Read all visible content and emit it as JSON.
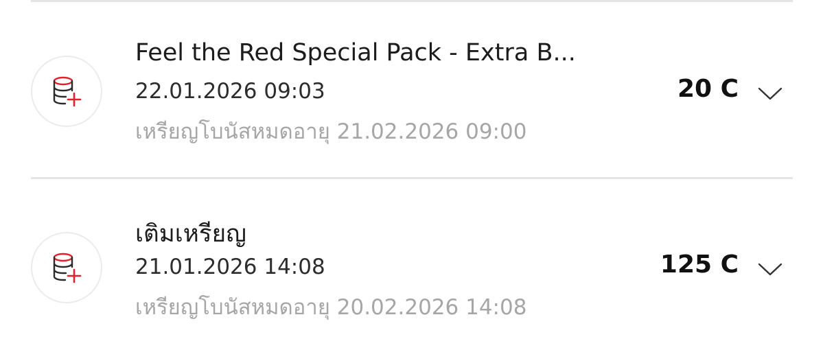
{
  "transactions": [
    {
      "title": "Feel the Red Special Pack - Extra B...",
      "date": "22.01.2026 09:03",
      "expiry": "เหรียญโบนัสหมดอายุ 21.02.2026 09:00",
      "amount": "20 C",
      "icon": "coin-stack-plus-icon",
      "expand_icon": "chevron-down-icon"
    },
    {
      "title": "เติมเหรียญ",
      "date": "21.01.2026 14:08",
      "expiry": "เหรียญโบนัสหมดอายุ 20.02.2026 14:08",
      "amount": "125 C",
      "icon": "coin-stack-plus-icon",
      "expand_icon": "chevron-down-icon"
    }
  ],
  "colors": {
    "accent_red": "#e4202e",
    "icon_dark": "#2a2a2a",
    "text_primary": "#1c1c1c",
    "text_secondary": "#a6a6a6",
    "divider": "#e5e5e5"
  }
}
